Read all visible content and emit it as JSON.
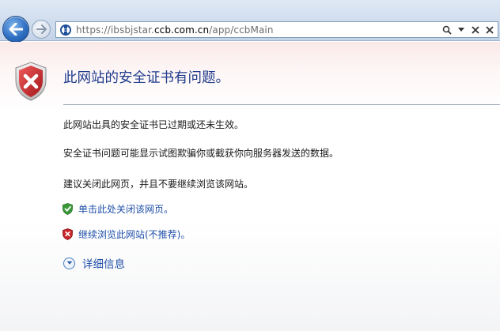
{
  "browser": {
    "back_label": "Back",
    "forward_label": "Forward",
    "url": {
      "prefix": "https://ibsbjstar.",
      "domain": "ccb.com.cn",
      "path": "/app/ccbMain"
    }
  },
  "error_page": {
    "title": "此网站的安全证书有问题。",
    "paragraphs": [
      "此网站出具的安全证书已过期或还未生效。",
      "安全证书问题可能显示试图欺骗你或截获你向服务器发送的数据。",
      "建议关闭此网页，并且不要继续浏览该网站。"
    ],
    "close_link": "单击此处关闭该网页。",
    "continue_link": "继续浏览此网站(不推荐)。",
    "more_info": "详细信息"
  },
  "colors": {
    "link": "#1f4fa8",
    "title": "#1f3b8c",
    "shield_red": "#c8262a",
    "shield_green": "#3a9a3a"
  },
  "icons": {
    "title_icon": "red-shield-x-icon",
    "close_icon": "green-shield-check-icon",
    "continue_icon": "red-shield-x-icon",
    "more_info_icon": "chevron-down-circle-icon"
  }
}
